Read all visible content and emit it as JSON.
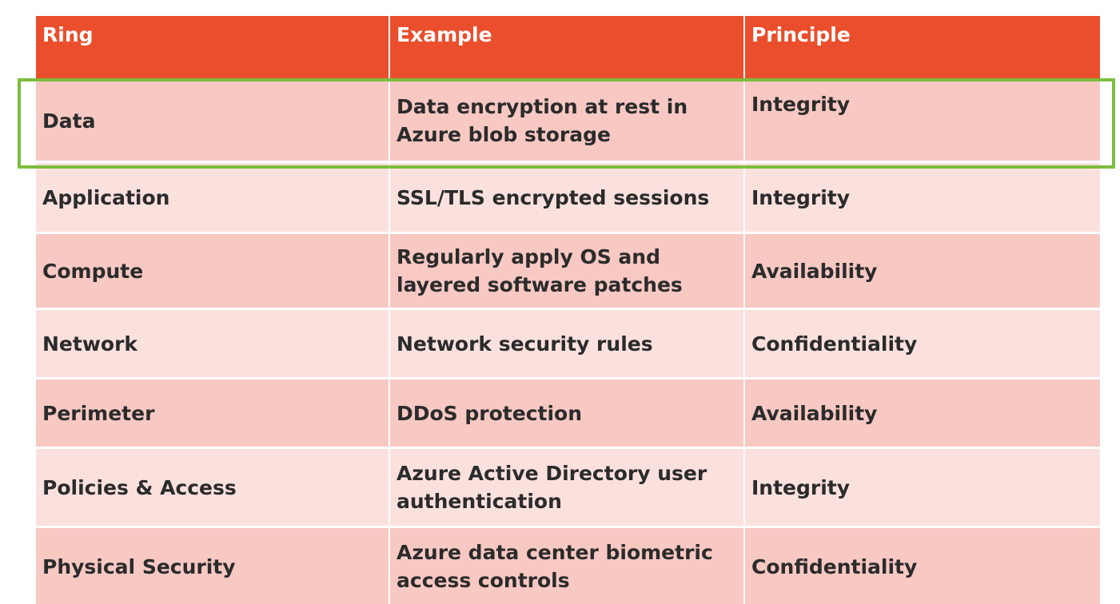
{
  "table": {
    "headers": [
      "Ring",
      "Example",
      "Principle"
    ],
    "rows": [
      {
        "ring": "Data",
        "example": "Data encryption at rest in Azure blob storage",
        "principle": "Integrity"
      },
      {
        "ring": "Application",
        "example": "SSL/TLS encrypted sessions",
        "principle": "Integrity"
      },
      {
        "ring": "Compute",
        "example": "Regularly apply OS and layered software patches",
        "principle": "Availability"
      },
      {
        "ring": "Network",
        "example": "Network security rules",
        "principle": "Confidentiality"
      },
      {
        "ring": "Perimeter",
        "example": "DDoS protection",
        "principle": "Availability"
      },
      {
        "ring": "Policies & Access",
        "example": "Azure Active Directory user authentication",
        "principle": "Integrity"
      },
      {
        "ring": "Physical Security",
        "example": "Azure data center biometric access controls",
        "principle": "Confidentiality"
      }
    ]
  },
  "colors": {
    "header_bg": "#ea4e2c",
    "row_dark": "#f8c8c3",
    "row_light": "#fbe1de",
    "highlight_border": "#7cbd3d"
  }
}
